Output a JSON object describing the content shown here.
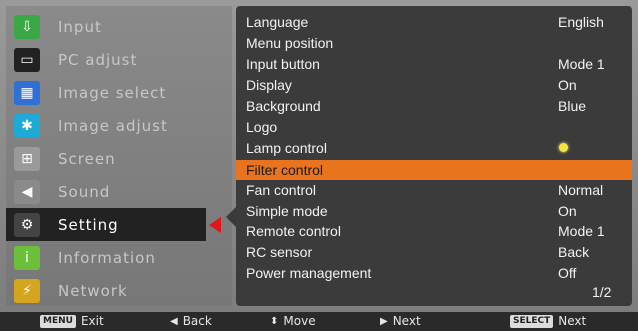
{
  "sidebar": {
    "items": [
      {
        "label": "Input",
        "icon": "input-icon",
        "color": "#3aa845"
      },
      {
        "label": "PC adjust",
        "icon": "monitor-icon",
        "color": "#222222"
      },
      {
        "label": "Image select",
        "icon": "image-select-icon",
        "color": "#2f6fd6"
      },
      {
        "label": "Image adjust",
        "icon": "image-adjust-icon",
        "color": "#1fa9d6"
      },
      {
        "label": "Screen",
        "icon": "screen-icon",
        "color": "#9a9a9a"
      },
      {
        "label": "Sound",
        "icon": "speaker-icon",
        "color": "#8a8a8a"
      },
      {
        "label": "Setting",
        "icon": "setting-icon",
        "color": "#333333"
      },
      {
        "label": "Information",
        "icon": "info-icon",
        "color": "#6bbf3a"
      },
      {
        "label": "Network",
        "icon": "network-icon",
        "color": "#f0c020"
      }
    ],
    "active_index": 6,
    "active_arrow_color": "#e0161a"
  },
  "settings": {
    "rows": [
      {
        "name": "Language",
        "value": "English"
      },
      {
        "name": "Menu position",
        "value": ""
      },
      {
        "name": "Input button",
        "value": "Mode 1"
      },
      {
        "name": "Display",
        "value": "On"
      },
      {
        "name": "Background",
        "value": "Blue"
      },
      {
        "name": "Logo",
        "value": ""
      },
      {
        "name": "Lamp control",
        "value": ""
      },
      {
        "name": "Filter control",
        "value": ""
      },
      {
        "name": "Fan control",
        "value": "Normal"
      },
      {
        "name": "Simple mode",
        "value": "On"
      },
      {
        "name": "Remote control",
        "value": "Mode 1"
      },
      {
        "name": "RC sensor",
        "value": "Back"
      },
      {
        "name": "Power management",
        "value": "Off"
      }
    ],
    "selected_index": 7,
    "highlight_color": "#e8741d",
    "page_indicator": "1/2"
  },
  "footer": {
    "menu_key": "MENU",
    "exit_label": "Exit",
    "back_label": "Back",
    "move_label": "Move",
    "next_label": "Next",
    "select_key": "SELECT",
    "select_next_label": "Next"
  }
}
